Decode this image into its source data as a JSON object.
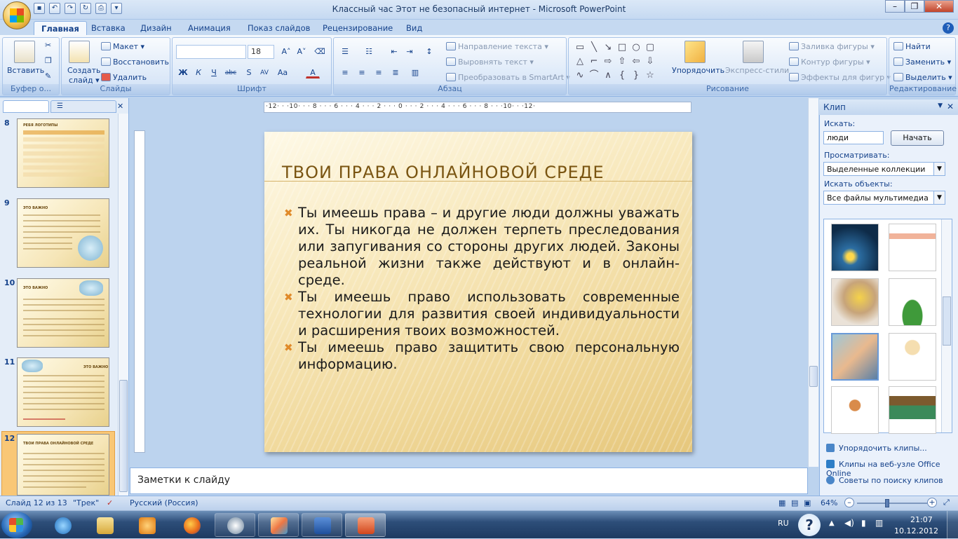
{
  "window": {
    "title": "Классный час Этот не безопасный интернет - Microsoft PowerPoint"
  },
  "qat": [
    "save-icon",
    "undo-icon",
    "redo-icon",
    "repeat-icon",
    "print-icon",
    "customize-icon"
  ],
  "tabs": [
    "Главная",
    "Вставка",
    "Дизайн",
    "Анимация",
    "Показ слайдов",
    "Рецензирование",
    "Вид"
  ],
  "ribbon": {
    "clipboard": {
      "label": "Буфер о...",
      "paste": "Вставить"
    },
    "slides": {
      "label": "Слайды",
      "new_slide_1": "Создать",
      "new_slide_2": "слайд ▾",
      "layout": "Макет ▾",
      "reset": "Восстановить",
      "delete": "Удалить"
    },
    "font": {
      "label": "Шрифт",
      "size": "18"
    },
    "paragraph": {
      "label": "Абзац",
      "text_direction": "Направление текста ▾",
      "align_text": "Выровнять текст ▾",
      "smartart": "Преобразовать в SmartArt ▾"
    },
    "drawing": {
      "label": "Рисование",
      "arrange": "Упорядочить",
      "quick_styles": "Экспресс-стили",
      "fill": "Заливка фигуры ▾",
      "outline": "Контур фигуры ▾",
      "effects": "Эффекты для фигур ▾"
    },
    "editing": {
      "label": "Редактирование",
      "find": "Найти",
      "replace": "Заменить ▾",
      "select": "Выделить ▾"
    }
  },
  "thumbnails": [
    {
      "num": "8",
      "title": "РЕБЯ ЛОГОТИПЫ"
    },
    {
      "num": "9",
      "title": "ЭТО ВАЖНО"
    },
    {
      "num": "10",
      "title": "ЭТО ВАЖНО"
    },
    {
      "num": "11",
      "title": "ЭТО ВАЖНО"
    },
    {
      "num": "12",
      "title": "ТВОИ ПРАВА ОНЛАЙНОВОЙ СРЕДЕ"
    }
  ],
  "ruler": {
    "h": "·12· · ·10· · · 8 · · · 6 · · · 4 · · · 2 · · · 0 · · · 2 · · · 4 · · · 6 · · · 8 · · ·10· · ·12·"
  },
  "slide": {
    "title": "ТВОИ ПРАВА ОНЛАЙНОВОЙ СРЕДЕ",
    "bullets": [
      "Ты имеешь права – и другие люди должны уважать их. Ты никогда не должен терпеть преследования или запугивания со стороны других людей. Законы реальной жизни также действуют и в онлайн-среде.",
      "Ты имеешь право использовать современные технологии для развития своей индивидуальности и расширения твоих возможностей.",
      "Ты имеешь право защитить свою персональную информацию."
    ]
  },
  "notes": {
    "placeholder": "Заметки к слайду"
  },
  "clip_pane": {
    "title": "Клип",
    "search_label": "Искать:",
    "search_value": "люди",
    "search_button": "Начать",
    "browse_label": "Просматривать:",
    "browse_value": "Выделенные коллекции",
    "types_label": "Искать объекты:",
    "types_value": "Все файлы мультимедиа",
    "links": [
      "Упорядочить клипы...",
      "Клипы на веб-узле Office Online",
      "Советы по поиску клипов"
    ]
  },
  "status": {
    "slide": "Слайд 12 из 13",
    "theme": "\"Трек\"",
    "language": "Русский (Россия)",
    "zoom": "64%"
  },
  "taskbar": {
    "lang": "RU",
    "time": "21:07",
    "date": "10.12.2012"
  }
}
